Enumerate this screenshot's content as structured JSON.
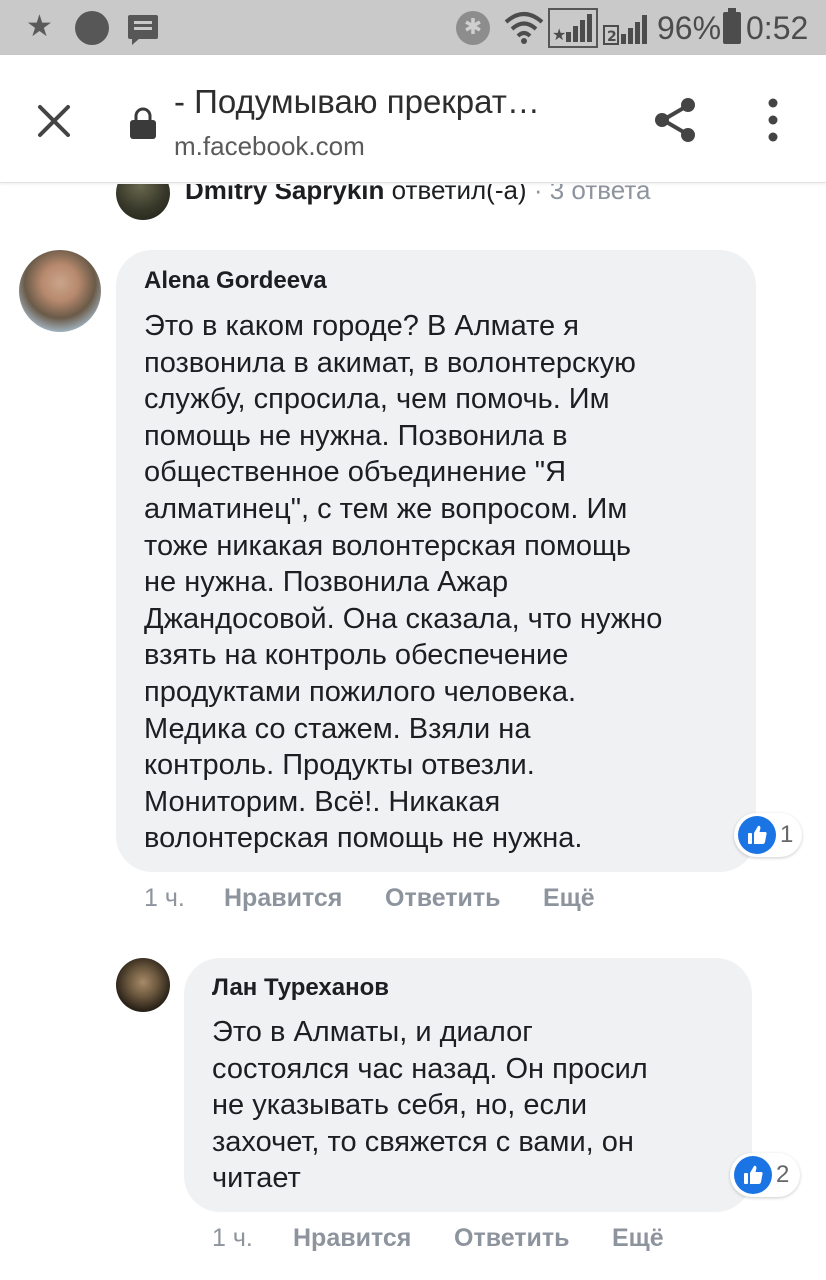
{
  "status_bar": {
    "battery": "96%",
    "time": "0:52",
    "icons": [
      "star-icon",
      "circle-icon",
      "message-icon",
      "bluetooth-icon",
      "wifi-icon",
      "signal-icon",
      "signal-2-icon",
      "battery-icon"
    ]
  },
  "browser": {
    "title": "- Подумываю прекрат…",
    "url": "m.facebook.com",
    "icons": [
      "close-icon",
      "lock-icon",
      "share-icon",
      "more-vert-icon"
    ]
  },
  "previous_reply": {
    "name": "Dmitry Saprykin",
    "action": "ответил(-а)",
    "separator": "·",
    "count": "3 ответа"
  },
  "comments": [
    {
      "author": "Alena Gordeeva",
      "text": "Это в каком городе? В Алмате я\nпозвонила в акимат, в волонтерскую\nслужбу, спросила, чем помочь. Им\nпомощь не нужна. Позвонила в\nобщественное объединение \"Я\nалматинец\", с тем же вопросом. Им\nтоже никакая волонтерская помощь\nне нужна. Позвонила Ажар\nДжандосовой. Она сказала, что нужно\nвзять на контроль обеспечение\nпродуктами пожилого человека.\nМедика со стажем. Взяли на\nконтроль. Продукты отвезли.\nМониторим. Всё!. Никакая\nволонтерская помощь не нужна.",
      "reactions": "1",
      "time": "1 ч.",
      "like": "Нравится",
      "reply": "Ответить",
      "more": "Ещё"
    },
    {
      "author": "Лан Туреханов",
      "text": "Это в Алматы, и диалог\nсостоялся час назад. Он просил\nне указывать себя, но, если\nзахочет, то свяжется с вами, он\nчитает",
      "reactions": "2",
      "time": "1 ч.",
      "like": "Нравится",
      "reply": "Ответить",
      "more": "Ещё"
    }
  ],
  "colors": {
    "status_bar": "#c9c9c9",
    "bubble": "#eff1f3",
    "like_blue": "#1b74e4",
    "muted": "#8d949e"
  }
}
